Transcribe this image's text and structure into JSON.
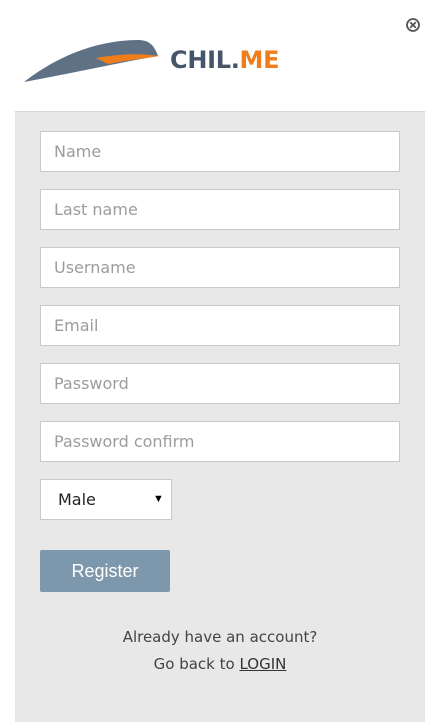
{
  "brand": {
    "name_primary": "CHIL.",
    "name_accent": "ME",
    "colors": {
      "text": "#46566a",
      "accent": "#f07d1a",
      "wing": "#5f7285"
    }
  },
  "close_icon": "close-circle-icon",
  "form": {
    "name_placeholder": "Name",
    "lastname_placeholder": "Last name",
    "username_placeholder": "Username",
    "email_placeholder": "Email",
    "password_placeholder": "Password",
    "password_confirm_placeholder": "Password confirm",
    "gender": {
      "selected": "Male",
      "options": [
        "Male"
      ],
      "arrow_icon": "caret-down-icon"
    },
    "register_label": "Register"
  },
  "footer": {
    "account_question": "Already have an account?",
    "go_back_prefix": "Go back to",
    "login_link": "LOGIN"
  },
  "colors": {
    "panel_background": "#e8e8e8",
    "button_background": "#7d97ad"
  }
}
